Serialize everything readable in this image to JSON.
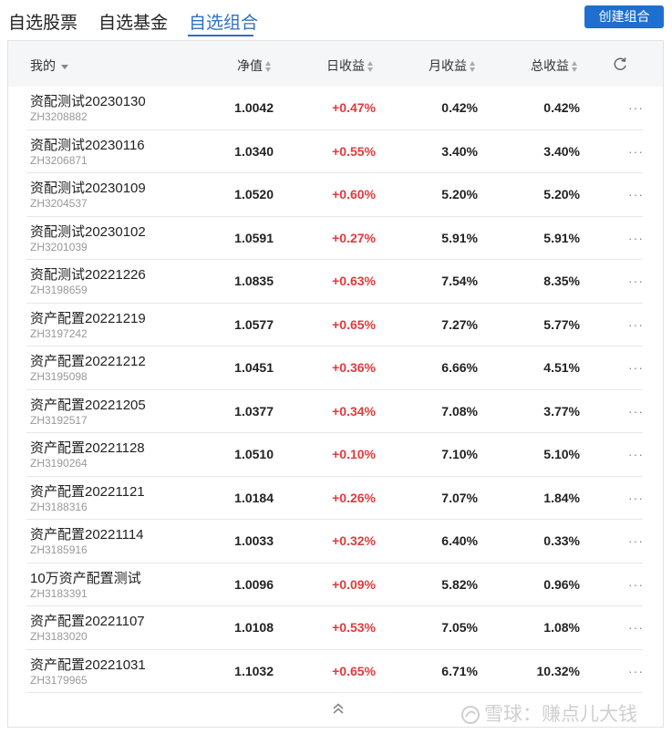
{
  "tabs": [
    {
      "label": "自选股票",
      "active": false
    },
    {
      "label": "自选基金",
      "active": false
    },
    {
      "label": "自选组合",
      "active": true
    }
  ],
  "create_button": "创建组合",
  "table": {
    "headers": {
      "mine": "我的",
      "nav": "净值",
      "day": "日收益",
      "month": "月收益",
      "total": "总收益"
    },
    "rows": [
      {
        "name": "资配测试20230130",
        "code": "ZH3208882",
        "nav": "1.0042",
        "day": "+0.47%",
        "month": "0.42%",
        "total": "0.42%"
      },
      {
        "name": "资配测试20230116",
        "code": "ZH3206871",
        "nav": "1.0340",
        "day": "+0.55%",
        "month": "3.40%",
        "total": "3.40%"
      },
      {
        "name": "资配测试20230109",
        "code": "ZH3204537",
        "nav": "1.0520",
        "day": "+0.60%",
        "month": "5.20%",
        "total": "5.20%"
      },
      {
        "name": "资配测试20230102",
        "code": "ZH3201039",
        "nav": "1.0591",
        "day": "+0.27%",
        "month": "5.91%",
        "total": "5.91%"
      },
      {
        "name": "资配测试20221226",
        "code": "ZH3198659",
        "nav": "1.0835",
        "day": "+0.63%",
        "month": "7.54%",
        "total": "8.35%"
      },
      {
        "name": "资产配置20221219",
        "code": "ZH3197242",
        "nav": "1.0577",
        "day": "+0.65%",
        "month": "7.27%",
        "total": "5.77%"
      },
      {
        "name": "资产配置20221212",
        "code": "ZH3195098",
        "nav": "1.0451",
        "day": "+0.36%",
        "month": "6.66%",
        "total": "4.51%"
      },
      {
        "name": "资产配置20221205",
        "code": "ZH3192517",
        "nav": "1.0377",
        "day": "+0.34%",
        "month": "7.08%",
        "total": "3.77%"
      },
      {
        "name": "资产配置20221128",
        "code": "ZH3190264",
        "nav": "1.0510",
        "day": "+0.10%",
        "month": "7.10%",
        "total": "5.10%"
      },
      {
        "name": "资产配置20221121",
        "code": "ZH3188316",
        "nav": "1.0184",
        "day": "+0.26%",
        "month": "7.07%",
        "total": "1.84%"
      },
      {
        "name": "资产配置20221114",
        "code": "ZH3185916",
        "nav": "1.0033",
        "day": "+0.32%",
        "month": "6.40%",
        "total": "0.33%"
      },
      {
        "name": "10万资产配置测试",
        "code": "ZH3183391",
        "nav": "1.0096",
        "day": "+0.09%",
        "month": "5.82%",
        "total": "0.96%"
      },
      {
        "name": "资产配置20221107",
        "code": "ZH3183020",
        "nav": "1.0108",
        "day": "+0.53%",
        "month": "7.05%",
        "total": "1.08%"
      },
      {
        "name": "资产配置20221031",
        "code": "ZH3179965",
        "nav": "1.1032",
        "day": "+0.65%",
        "month": "6.71%",
        "total": "10.32%"
      }
    ]
  },
  "icons": {
    "refresh": "refresh-icon",
    "more": "more-icon",
    "collapse": "chevron-up-double-icon"
  },
  "watermark": "雪球：赚点儿大钱",
  "colors": {
    "accent": "#2f6fc4",
    "button": "#1f6fd0",
    "positive": "#e4393c"
  }
}
